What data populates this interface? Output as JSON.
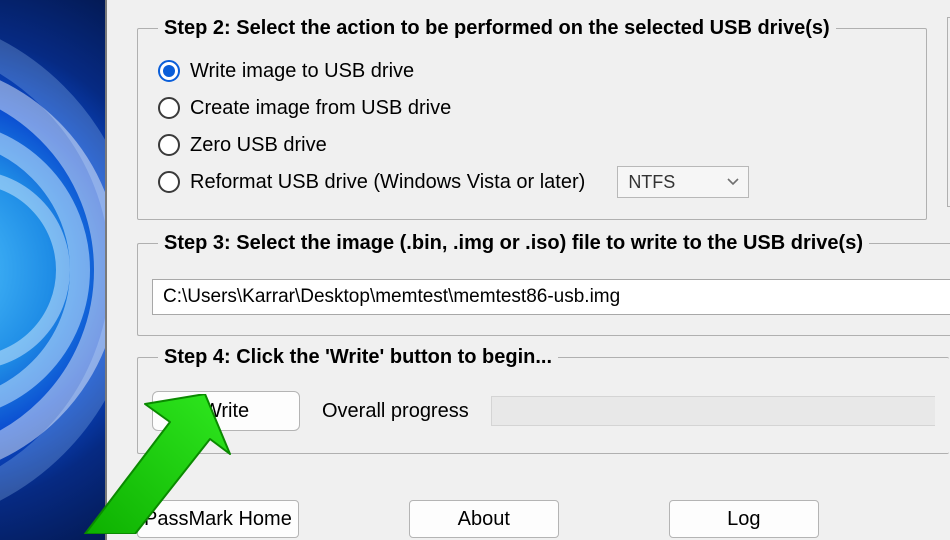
{
  "step2": {
    "legend": "Step 2: Select the action to be performed on the selected USB drive(s)",
    "options": {
      "write": "Write image to USB drive",
      "create": "Create image from USB drive",
      "zero": "Zero USB drive",
      "reformat": "Reformat USB drive (Windows Vista or later)"
    },
    "selected": "write",
    "format_select": {
      "value": "NTFS"
    }
  },
  "step3": {
    "legend": "Step 3: Select the image (.bin, .img or .iso) file to write to the USB drive(s)",
    "path": "C:\\Users\\Karrar\\Desktop\\memtest\\memtest86-usb.img"
  },
  "step4": {
    "legend": "Step 4: Click the 'Write' button to begin...",
    "write_btn": "Write",
    "progress_label": "Overall progress"
  },
  "footer": {
    "passmark": "PassMark Home",
    "about": "About",
    "log": "Log"
  }
}
